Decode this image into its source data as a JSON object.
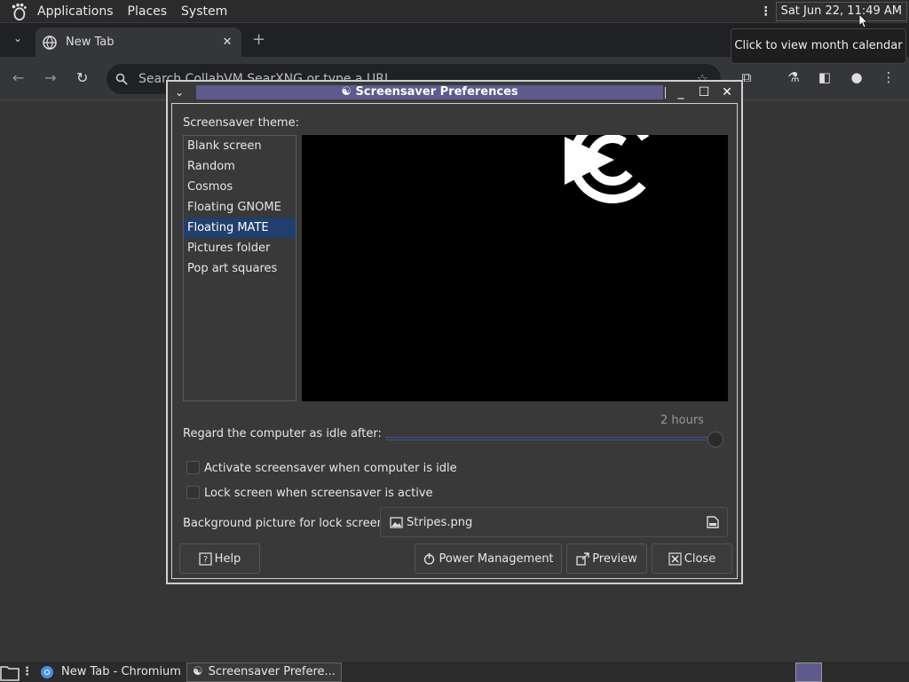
{
  "topbar": {
    "menus": [
      "Applications",
      "Places",
      "System"
    ],
    "clock": "Sat Jun 22, 11:49 AM",
    "tooltip": "Click to view month calendar"
  },
  "browser": {
    "tab_title": "New Tab",
    "omnibox_placeholder": "Search CollabVM SearXNG or type a URL"
  },
  "dialog": {
    "title": "Screensaver Preferences",
    "theme_label": "Screensaver theme:",
    "themes": [
      "Blank screen",
      "Random",
      "Cosmos",
      "Floating GNOME",
      "Floating MATE",
      "Pictures folder",
      "Pop art squares"
    ],
    "selected_theme": "Floating MATE",
    "idle_label": "Regard the computer as idle after:",
    "idle_value": "2 hours",
    "idle_fraction": 1.0,
    "activate_label": "Activate screensaver when computer is idle",
    "activate_checked": false,
    "lock_label": "Lock screen when screensaver is active",
    "lock_checked": false,
    "bg_label": "Background picture for lock screen:",
    "bg_file": "Stripes.png",
    "help_label": "Help",
    "power_label": "Power Management",
    "preview_label": "Preview",
    "close_label": "Close"
  },
  "taskbar": {
    "items": [
      "New Tab - Chromium",
      "Screensaver Prefere..."
    ]
  },
  "colors": {
    "title_active": "#5e5a8c",
    "selection": "#203e6e",
    "slider_fill": "#1b3e73"
  }
}
